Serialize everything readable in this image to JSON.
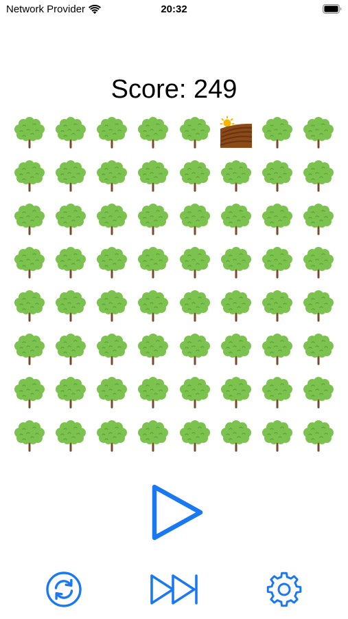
{
  "status_bar": {
    "carrier": "Network Provider",
    "time": "20:32",
    "wifi_icon": "wifi-icon",
    "battery_icon": "battery-icon"
  },
  "score": {
    "text": "Score: 249"
  },
  "board": {
    "rows": 8,
    "cols": 8,
    "cells": [
      [
        "tree",
        "tree",
        "tree",
        "tree",
        "tree",
        "farmland",
        "tree",
        "tree"
      ],
      [
        "tree",
        "tree",
        "tree",
        "tree",
        "tree",
        "tree",
        "tree",
        "tree"
      ],
      [
        "tree",
        "tree",
        "tree",
        "tree",
        "tree",
        "tree",
        "tree",
        "tree"
      ],
      [
        "tree",
        "tree",
        "tree",
        "tree",
        "tree",
        "tree",
        "tree",
        "tree"
      ],
      [
        "tree",
        "tree",
        "tree",
        "tree",
        "tree",
        "tree",
        "tree",
        "tree"
      ],
      [
        "tree",
        "tree",
        "tree",
        "tree",
        "tree",
        "tree",
        "tree",
        "tree"
      ],
      [
        "tree",
        "tree",
        "tree",
        "tree",
        "tree",
        "tree",
        "tree",
        "tree"
      ],
      [
        "tree",
        "tree",
        "tree",
        "tree",
        "tree",
        "tree",
        "tree",
        "tree"
      ]
    ]
  },
  "controls": {
    "play_icon": "play-icon",
    "reset_icon": "reset-icon",
    "fast_forward_icon": "fast-forward-icon",
    "settings_icon": "gear-icon",
    "accent_color": "#1a78f2"
  },
  "colors": {
    "tree_foliage": "#7cc24f",
    "tree_foliage_dark": "#5ea83a",
    "tree_trunk": "#7a4a2a",
    "field_brown": "#8b4a17",
    "field_dark": "#6a3510",
    "sun": "#f7b500"
  }
}
